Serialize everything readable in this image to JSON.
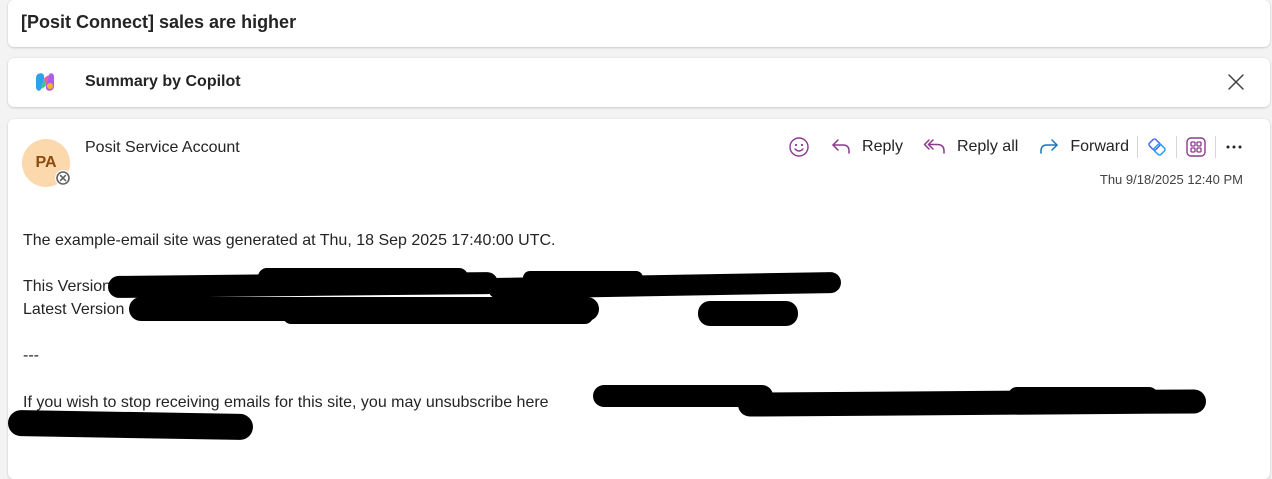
{
  "subject": "[Posit Connect] sales are higher",
  "copilot": {
    "label": "Summary by Copilot",
    "close_icon": "close-icon",
    "logo_icon": "copilot-logo-icon"
  },
  "message": {
    "avatar_initials": "PA",
    "sender": "Posit Service Account",
    "timestamp": "Thu 9/18/2025 12:40 PM",
    "actions": {
      "emoji_icon": "emoji-icon",
      "reply": "Reply",
      "reply_all": "Reply all",
      "forward": "Forward",
      "more_icon": "more-icon"
    },
    "body": {
      "generated_line": "The example-email site was generated at Thu, 18 Sep 2025 17:40:00 UTC.",
      "this_version_label": "This Version",
      "latest_version_label": "Latest Version",
      "separator": "---",
      "unsubscribe_line": "If you wish to stop receiving emails for this site, you may unsubscribe here"
    }
  },
  "colors": {
    "avatar_bg": "#fcd8ad",
    "avatar_text": "#8a4b0f",
    "reply_icon": "#8b3a8f",
    "forward_icon": "#1f6fc5",
    "link": "#0f3bd8",
    "redaction": "#000000"
  }
}
